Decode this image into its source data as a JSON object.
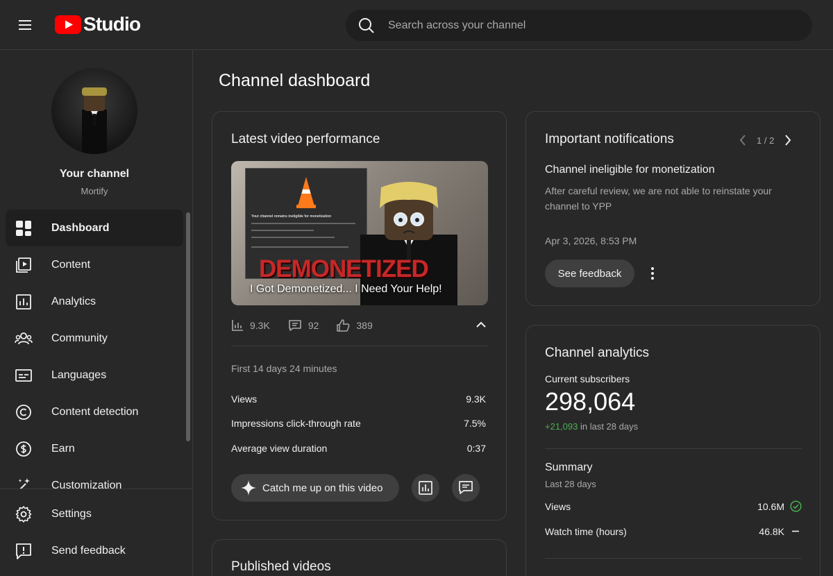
{
  "header": {
    "logo_text": "Studio",
    "search_placeholder": "Search across your channel"
  },
  "sidebar": {
    "channel_title": "Your channel",
    "channel_handle": "Mortify",
    "items": [
      {
        "label": "Dashboard",
        "icon": "dashboard-icon",
        "active": true
      },
      {
        "label": "Content",
        "icon": "content-icon"
      },
      {
        "label": "Analytics",
        "icon": "analytics-icon"
      },
      {
        "label": "Community",
        "icon": "community-icon"
      },
      {
        "label": "Languages",
        "icon": "languages-icon"
      },
      {
        "label": "Content detection",
        "icon": "copyright-icon"
      },
      {
        "label": "Earn",
        "icon": "dollar-icon"
      },
      {
        "label": "Customization",
        "icon": "magic-wand-icon"
      }
    ],
    "bottom_items": [
      {
        "label": "Settings",
        "icon": "gear-icon"
      },
      {
        "label": "Send feedback",
        "icon": "feedback-icon"
      }
    ]
  },
  "main": {
    "page_title": "Channel dashboard",
    "latest_video": {
      "title": "Latest video performance",
      "thumbnail_title": "I Got Demonetized... I Need Your Help!",
      "thumbnail_overlay_text": "DEMONETIZED",
      "thumbnail_panel_text": "Your channel remains ineligible for monetization",
      "views_short": "9.3K",
      "comments": "92",
      "likes": "389",
      "period": "First 14 days 24 minutes",
      "metrics": [
        {
          "label": "Views",
          "value": "9.3K"
        },
        {
          "label": "Impressions click-through rate",
          "value": "7.5%"
        },
        {
          "label": "Average view duration",
          "value": "0:37"
        }
      ],
      "catch_up_label": "Catch me up on this video"
    },
    "published_videos": {
      "title": "Published videos"
    },
    "notifications": {
      "title": "Important notifications",
      "pager": "1 / 2",
      "heading": "Channel ineligible for monetization",
      "body": "After careful review, we are not able to reinstate your channel to YPP",
      "date": "Apr 3, 2026, 8:53 PM",
      "feedback_label": "See feedback"
    },
    "analytics": {
      "title": "Channel analytics",
      "subs_label": "Current subscribers",
      "subs_value": "298,064",
      "subs_delta": "+21,093",
      "subs_delta_suffix": " in last 28 days",
      "summary_title": "Summary",
      "summary_sub": "Last 28 days",
      "rows": [
        {
          "label": "Views",
          "value": "10.6M"
        },
        {
          "label": "Watch time (hours)",
          "value": "46.8K"
        }
      ]
    }
  },
  "colors": {
    "background": "#282828",
    "brand_red": "#ff0000",
    "positive_green": "#4caf50"
  }
}
